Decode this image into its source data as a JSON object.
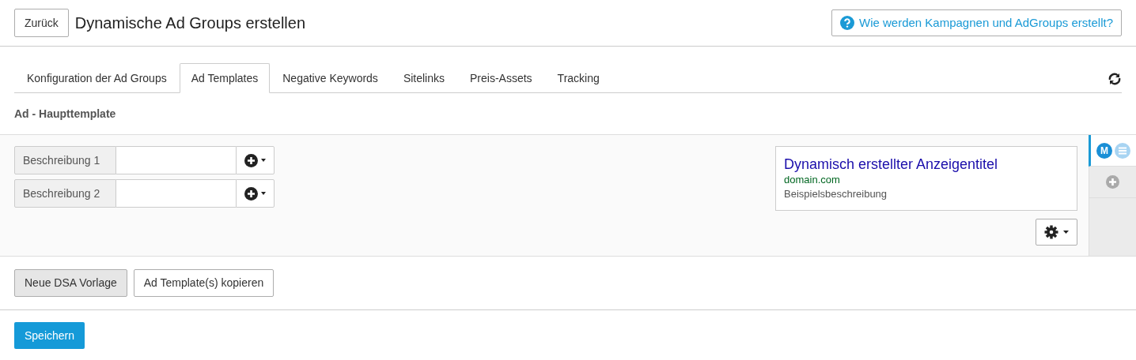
{
  "header": {
    "back_button": "Zurück",
    "title": "Dynamische Ad Groups erstellen",
    "help_link": "Wie werden Kampagnen und AdGroups erstellt?"
  },
  "tabs": [
    {
      "label": "Konfiguration der Ad Groups",
      "selected": false
    },
    {
      "label": "Ad Templates",
      "selected": true
    },
    {
      "label": "Negative Keywords",
      "selected": false
    },
    {
      "label": "Sitelinks",
      "selected": false
    },
    {
      "label": "Preis-Assets",
      "selected": false
    },
    {
      "label": "Tracking",
      "selected": false
    }
  ],
  "section_title": "Ad - Haupttemplate",
  "fields": [
    {
      "label": "Beschreibung 1"
    },
    {
      "label": "Beschreibung 2"
    }
  ],
  "preview": {
    "title": "Dynamisch erstellter Anzeigentitel",
    "domain": "domain.com",
    "description": "Beispielsbeschreibung"
  },
  "side_tabs": [
    {
      "kind": "template",
      "badge": "M",
      "selected": true
    },
    {
      "kind": "add",
      "selected": false
    }
  ],
  "actions": [
    {
      "label": "Neue DSA Vorlage",
      "pressed": true
    },
    {
      "label": "Ad Template(s) kopieren",
      "pressed": false
    }
  ],
  "save_button": "Speichern"
}
